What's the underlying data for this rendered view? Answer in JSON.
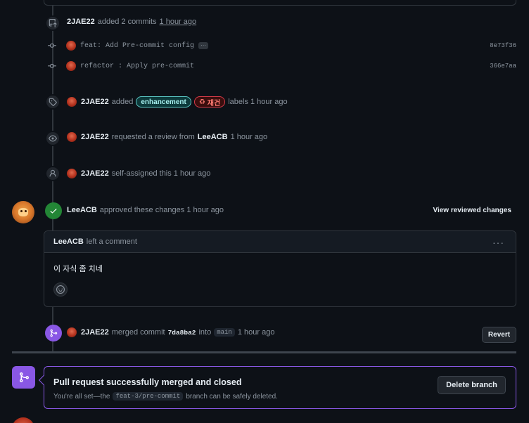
{
  "commits_event": {
    "user": "2JAE22",
    "action": "added 2 commits",
    "time": "1 hour ago",
    "commits": [
      {
        "message": "feat: Add Pre-commit config",
        "sha": "8e73f36",
        "has_more": "···"
      },
      {
        "message": "refactor : Apply pre-commit",
        "sha": "366e7aa"
      }
    ]
  },
  "label_event": {
    "user": "2JAE22",
    "action": "added",
    "labels": [
      "enhancement",
      "재건"
    ],
    "suffix": "labels 1 hour ago"
  },
  "review_request_event": {
    "user": "2JAE22",
    "action": "requested a review from",
    "reviewer": "LeeACB",
    "time": "1 hour ago"
  },
  "assign_event": {
    "user": "2JAE22",
    "action": "self-assigned this 1 hour ago"
  },
  "approval_event": {
    "user": "LeeACB",
    "action": "approved these changes 1 hour ago",
    "view_changes_label": "View reviewed changes"
  },
  "comment": {
    "author": "LeeACB",
    "action": "left a comment",
    "menu_label": "···",
    "body": "이 자식 좀 치네"
  },
  "merge_event": {
    "user": "2JAE22",
    "action": "merged commit",
    "commit": "7da8ba2",
    "into": "into",
    "branch": "main",
    "time": "1 hour ago",
    "revert_label": "Revert"
  },
  "merged_banner": {
    "title": "Pull request successfully merged and closed",
    "sub_prefix": "You're all set—the",
    "branch": "feat-3/pre-commit",
    "sub_suffix": "branch can be safely deleted.",
    "delete_label": "Delete branch"
  },
  "colors": {
    "background": "#0d1117",
    "merged_purple": "#8957e5",
    "approved_green": "#238636"
  }
}
